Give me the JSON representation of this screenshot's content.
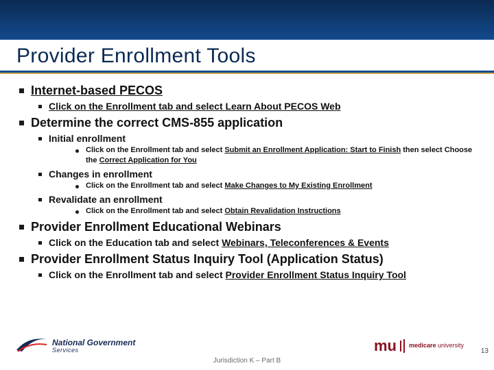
{
  "title": "Provider Enrollment Tools",
  "sections": [
    {
      "label": "Internet-based PECOS",
      "underline": true,
      "children": [
        {
          "pre": "Click on the Enrollment tab and select ",
          "link": "Learn About PECOS Web",
          "post": ""
        }
      ]
    },
    {
      "label": "Determine the correct CMS-855 application",
      "underline": false,
      "children": [
        {
          "text": "Initial enrollment",
          "children": [
            {
              "pre": "Click on the Enrollment tab and select ",
              "link": "Submit an Enrollment Application: Start to Finish",
              "post": " then select Choose the ",
              "link2": "Correct Application for You"
            }
          ]
        },
        {
          "text": "Changes in enrollment",
          "children": [
            {
              "pre": "Click on the Enrollment tab and select ",
              "link": "Make Changes to My Existing Enrollment",
              "post": ""
            }
          ]
        },
        {
          "text": "Revalidate an enrollment",
          "children": [
            {
              "pre": "Click on the Enrollment tab and select ",
              "link": "Obtain Revalidation Instructions",
              "post": ""
            }
          ]
        }
      ]
    },
    {
      "label": "Provider Enrollment Educational Webinars",
      "underline": false,
      "children": [
        {
          "pre": "Click on the Education tab and select ",
          "link": "Webinars, Teleconferences & Events",
          "post": ""
        }
      ]
    },
    {
      "label": "Provider Enrollment Status Inquiry Tool (Application Status)",
      "underline": false,
      "children": [
        {
          "pre": "Click on the Enrollment tab and select ",
          "link": "Provider Enrollment Status Inquiry Tool",
          "post": ""
        }
      ]
    }
  ],
  "footer": {
    "ngs_top": "National Government",
    "ngs_bottom": "Services",
    "jurisdiction": "Jurisdiction K – Part B",
    "mu_label": "mu",
    "mu_line1": "medicare",
    "mu_line2": "university",
    "page": "13"
  }
}
